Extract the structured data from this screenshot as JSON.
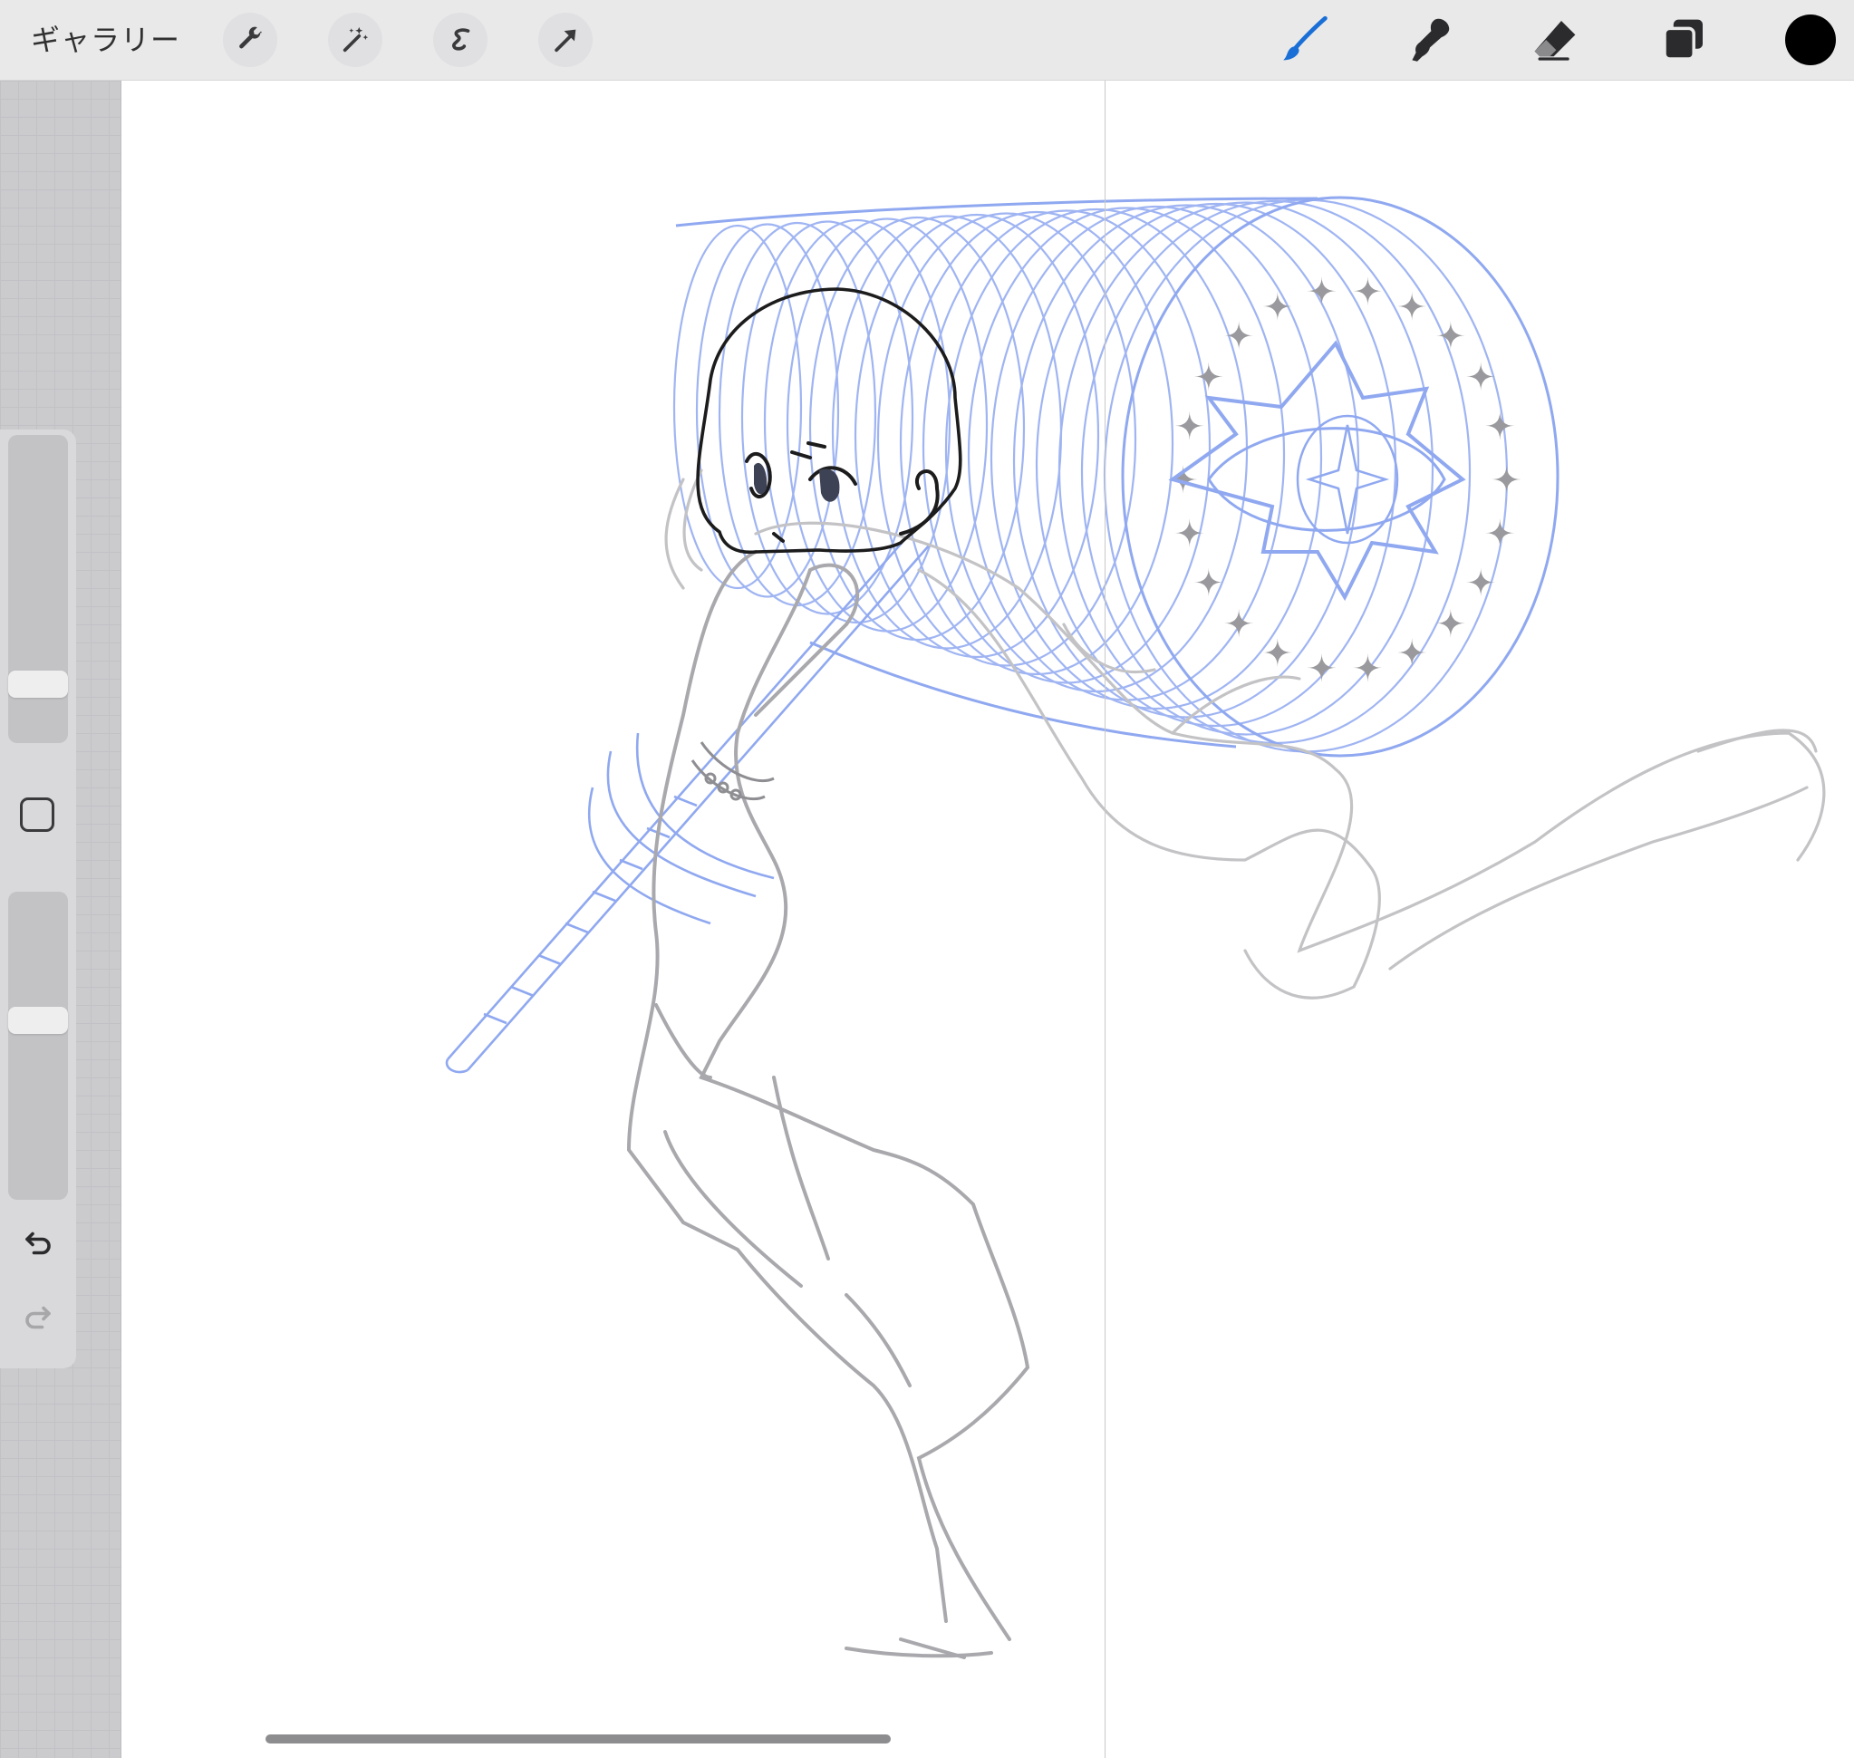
{
  "toolbar": {
    "gallery_label": "ギャラリー",
    "left_tools": [
      "wrench-icon",
      "magic-wand-icon",
      "selection-icon",
      "transform-arrow-icon"
    ],
    "right_tools": [
      "brush-icon",
      "smudge-icon",
      "eraser-icon",
      "layers-icon"
    ],
    "active_tool": "brush-icon",
    "active_tool_color": "#1a6fd6",
    "current_color": "#000000"
  },
  "sidebar": {
    "brush_size": 0.16,
    "brush_opacity": 0.59,
    "tools": [
      "modify-square-icon",
      "undo-icon",
      "redo-icon"
    ],
    "redo_enabled": false
  },
  "canvas": {
    "background": "#ffffff",
    "sketch_colors": {
      "line_art": "#1c1c1c",
      "rough_sketch": "#a9a9ad",
      "guide_sketch": "#8fa8f0"
    }
  }
}
